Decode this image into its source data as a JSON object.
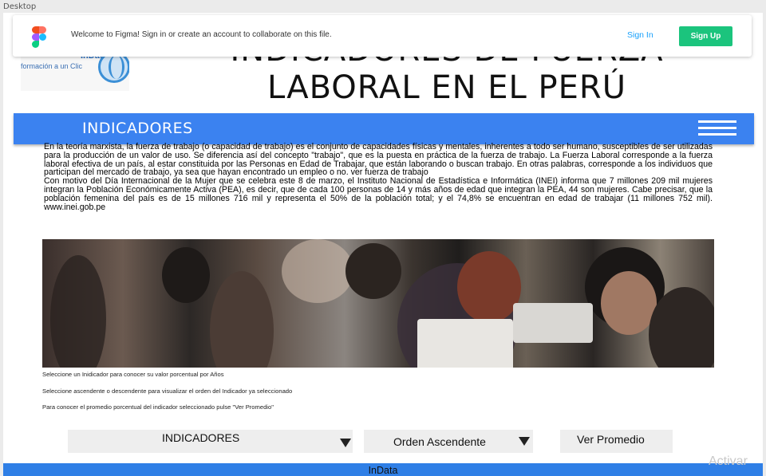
{
  "desktop_label": "Desktop",
  "logo": {
    "brand": "InData",
    "tagline": "formación a un Clic"
  },
  "header": {
    "title": "INDICADORES DE FUERZA LABORAL EN EL PERÚ"
  },
  "figma_banner": {
    "message": "Welcome to Figma! Sign in or create an account to collaborate on this file.",
    "sign_in": "Sign In",
    "sign_up": "Sign Up"
  },
  "nav": {
    "title": "INDICADORES"
  },
  "content": {
    "paragraph1": "En la teoría marxista, la fuerza de trabajo (o capacidad de trabajo) es el conjunto de capacidades físicas y mentales, inherentes a todo ser humano, susceptibles de ser utilizadas para la producción de un valor de uso. Se diferencia así del concepto \"trabajo\", que es la puesta en práctica de la fuerza de trabajo. La Fuerza Laboral corresponde a la fuerza laboral efectiva de un país, al estar constituida por las Personas en Edad de Trabajar, que están laborando o buscan trabajo. En otras palabras, corresponde a los individuos que participan del mercado de trabajo, ya sea que hayan encontrado un empleo o no. ver fuerza de trabajo",
    "paragraph2": "Con motivo del Día Internacional de la Mujer que se celebra este 8 de marzo, el Instituto Nacional de Estadística e Informática (INEI) informa que 7 millones 209 mil mujeres integran la Población Económicamente Activa (PEA), es decir, que de cada 100 personas de 14 y más años de edad que integran la PEA, 44 son mujeres. Cabe precisar, que la población femenina del país es de 15 millones 716 mil y representa el 50% de la población total; y el 74,8% se encuentran en edad de trabajar (11 millones 752 mil). www.inei.gob.pe"
  },
  "instructions": [
    "Seleccione un Inidicador para conocer su valor porcentual por Años",
    "Seleccione ascendente o descendente para visualizar el orden del Indicador ya seleccionado",
    "Para conocer el promedio porcentual del indicador seleccionado pulse \"Ver Promedio\""
  ],
  "controls": {
    "indicator_select": "INDICADORES",
    "order_select": "Orden Ascendente",
    "average_button": "Ver Promedio"
  },
  "footer": {
    "text": "InData"
  },
  "watermark": "Activar",
  "colors": {
    "nav_blue": "#3b82f0",
    "footer_blue": "#2f7fe6",
    "figma_green": "#1bc47d",
    "figma_link": "#18a0fb"
  }
}
